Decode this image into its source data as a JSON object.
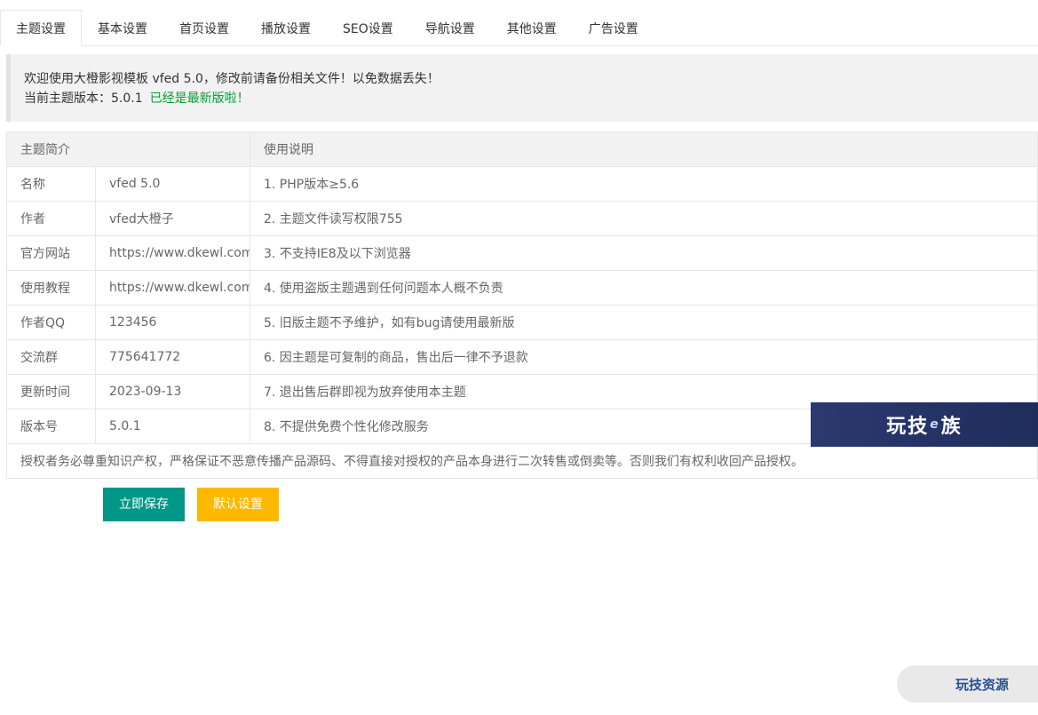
{
  "tabs": [
    {
      "label": "主题设置",
      "active": true
    },
    {
      "label": "基本设置",
      "active": false
    },
    {
      "label": "首页设置",
      "active": false
    },
    {
      "label": "播放设置",
      "active": false
    },
    {
      "label": "SEO设置",
      "active": false
    },
    {
      "label": "导航设置",
      "active": false
    },
    {
      "label": "其他设置",
      "active": false
    },
    {
      "label": "广告设置",
      "active": false
    }
  ],
  "notice": {
    "line1": "欢迎使用大橙影视模板 vfed 5.0，修改前请备份相关文件！以免数据丢失！",
    "line2_prefix": "当前主题版本：5.0.1",
    "line2_status": "已经是最新版啦！"
  },
  "table": {
    "header_intro": "主题简介",
    "header_usage": "使用说明",
    "rows": [
      {
        "key": "名称",
        "value": "vfed 5.0",
        "note": "1. PHP版本≥5.6"
      },
      {
        "key": "作者",
        "value": "vfed大橙子",
        "note": "2. 主题文件读写权限755"
      },
      {
        "key": "官方网站",
        "value": "https://www.dkewl.com",
        "note": "3. 不支持IE8及以下浏览器"
      },
      {
        "key": "使用教程",
        "value": "https://www.dkewl.com",
        "note": "4. 使用盗版主题遇到任何问题本人概不负责"
      },
      {
        "key": "作者QQ",
        "value": "123456",
        "note": "5. 旧版主题不予维护，如有bug请使用最新版"
      },
      {
        "key": "交流群",
        "value": "775641772",
        "note": "6. 因主题是可复制的商品，售出后一律不予退款"
      },
      {
        "key": "更新时间",
        "value": "2023-09-13",
        "note": "7. 退出售后群即视为放弃使用本主题"
      },
      {
        "key": "版本号",
        "value": "5.0.1",
        "note": "8. 不提供免费个性化修改服务"
      }
    ],
    "footer": "授权者务必尊重知识产权，严格保证不恶意传播产品源码、不得直接对授权的产品本身进行二次转售或倒卖等。否则我们有权利收回产品授权。"
  },
  "buttons": {
    "save": "立即保存",
    "default": "默认设置"
  },
  "watermark": {
    "banner_left": "玩技",
    "banner_mid": "e",
    "banner_right": "族",
    "pill": "玩技资源"
  },
  "colors": {
    "save_button": "#009688",
    "default_button": "#ffb800",
    "status_ok": "#009f2f"
  }
}
